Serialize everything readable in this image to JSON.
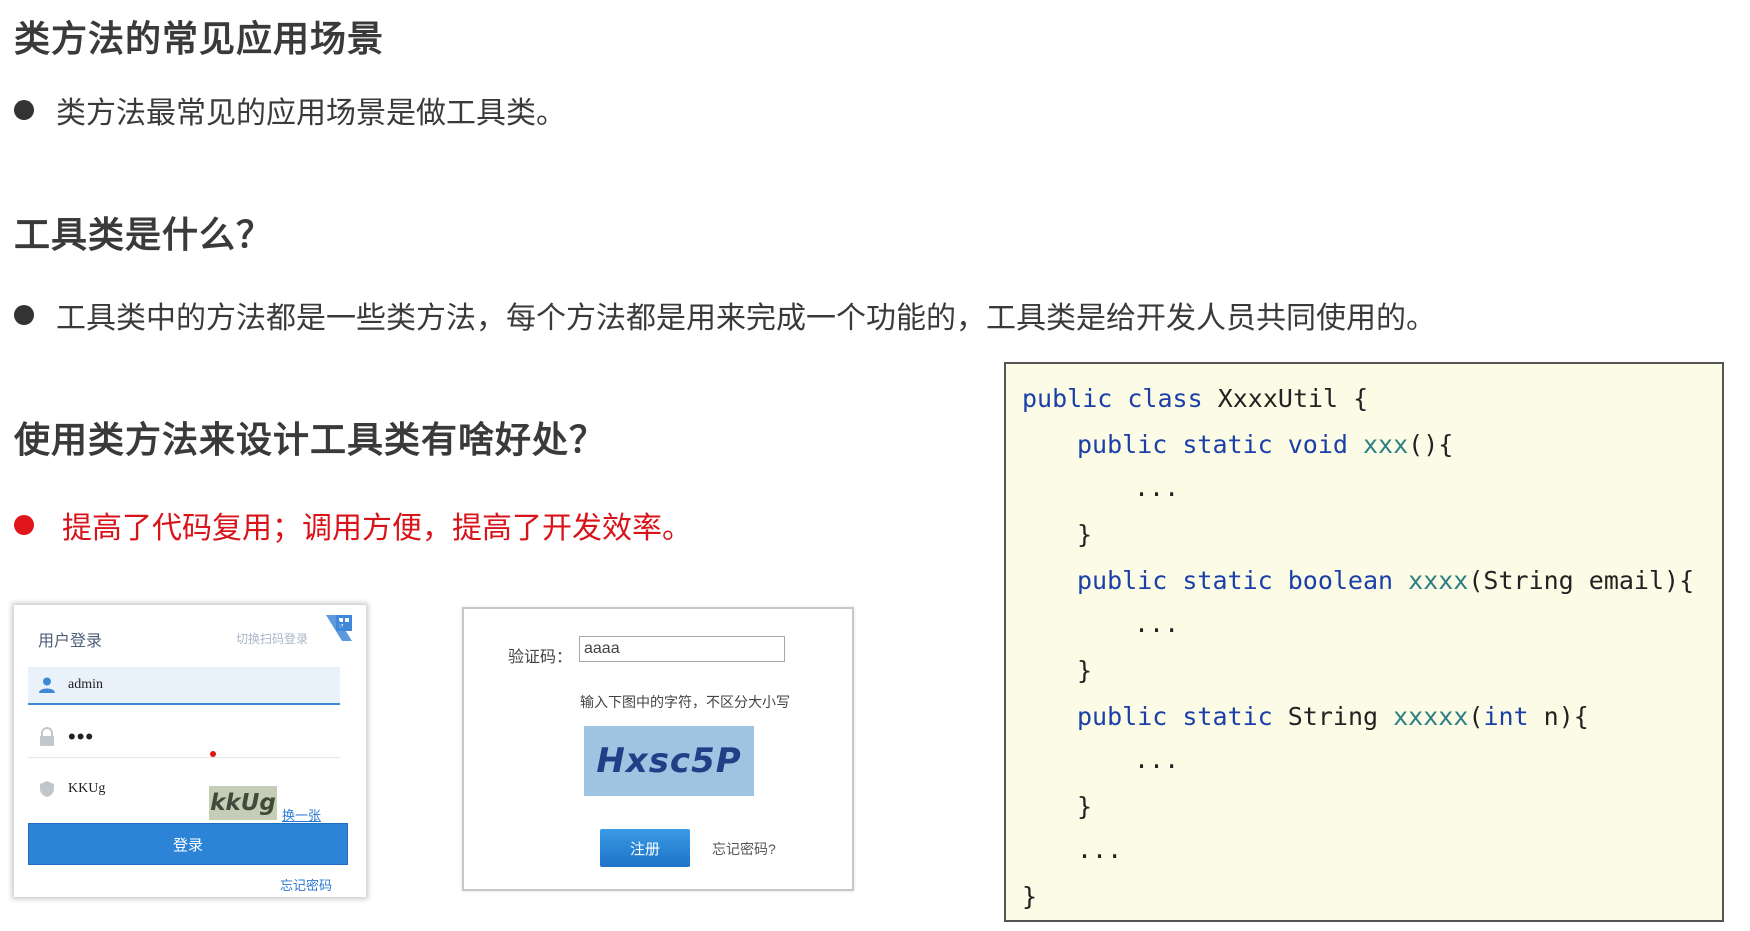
{
  "sections": [
    {
      "title": "类方法的常见应用场景",
      "bullet": "类方法最常见的应用场景是做工具类。"
    },
    {
      "title": "工具类是什么？",
      "bullet": "工具类中的方法都是一些类方法，每个方法都是用来完成一个功能的，工具类是给开发人员共同使用的。"
    },
    {
      "title": "使用类方法来设计工具类有啥好处？",
      "bullet": "提高了代码复用；调用方便，提高了开发效率。",
      "bullet_color": "#d8141b"
    }
  ],
  "code": {
    "l1_kw": "public class",
    "l1_name": "XxxxUtil {",
    "l2_kw": "public static void",
    "l2_fn": "xxx",
    "l2_rest": "(){",
    "l3": "...",
    "l4": "}",
    "l5_kw": "public static boolean",
    "l5_fn": "xxxx",
    "l5_rest": "(String email){",
    "l6": "...",
    "l7": "}",
    "l8_kw": "public static",
    "l8_type": "String",
    "l8_fn": "xxxxx",
    "l8_paren": "(",
    "l8_int": "int",
    "l8_rest": " n){",
    "l9": "...",
    "l10": "}",
    "l11": "...",
    "l12": "}"
  },
  "login_panel": {
    "title": "用户登录",
    "switch_link": "切换扫码登录",
    "username": "admin",
    "password_mask": "•••",
    "captcha_input": "KKUg",
    "captcha_image_text": "kkUg",
    "change_link": "换一张",
    "login_button": "登录",
    "forgot_link": "忘记密码"
  },
  "verify_panel": {
    "label": "验证码：",
    "input_value": "aaaa",
    "hint": "输入下图中的字符，不区分大小写",
    "captcha_text": "Hxsc5P",
    "register_button": "注册",
    "forgot_link": "忘记密码?"
  },
  "colors": {
    "keyword": "#1a3fa8",
    "function": "#2d7f83",
    "code_bg": "#fcfbe6",
    "accent_red": "#e0141b",
    "button_blue": "#2d83d6"
  }
}
